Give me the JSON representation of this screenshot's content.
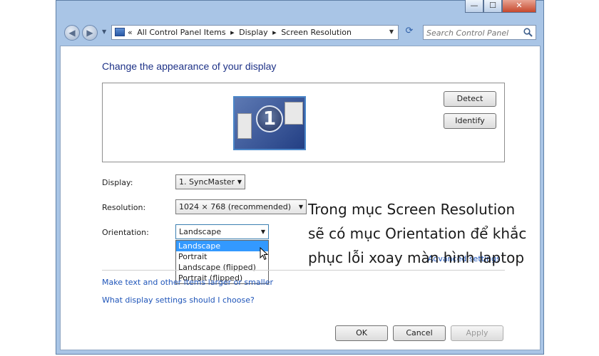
{
  "window": {
    "minimize_glyph": "—",
    "maximize_glyph": "☐",
    "close_glyph": "✕"
  },
  "nav": {
    "back_glyph": "◀",
    "forward_glyph": "▶",
    "breadcrumb": [
      "All Control Panel Items",
      "Display",
      "Screen Resolution"
    ],
    "breadcrumb_sep": "▸",
    "overflow": "«",
    "search_placeholder": "Search Control Panel"
  },
  "page": {
    "title": "Change the appearance of your display",
    "monitor_number": "1",
    "detect_label": "Detect",
    "identify_label": "Identify"
  },
  "settings": {
    "display_label": "Display:",
    "display_value": "1. SyncMaster",
    "resolution_label": "Resolution:",
    "resolution_value": "1024 × 768 (recommended)",
    "orientation_label": "Orientation:",
    "orientation_value": "Landscape",
    "orientation_options": [
      "Landscape",
      "Portrait",
      "Landscape (flipped)",
      "Portrait (flipped)"
    ]
  },
  "links": {
    "advanced": "Advanced settings",
    "make_text": "Make text and other items larger or smaller",
    "what_settings": "What display settings should I choose?"
  },
  "footer": {
    "ok_label": "OK",
    "cancel_label": "Cancel",
    "apply_label": "Apply"
  },
  "overlay_caption": [
    "Trong mục Screen Resolution",
    "sẽ có mục Orientation để khắc",
    "phục lỗi xoay màn hình laptop"
  ]
}
